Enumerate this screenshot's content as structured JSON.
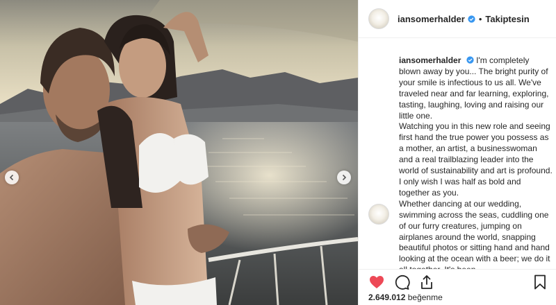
{
  "post": {
    "photo_alt": "Couple embracing on a boat at sunset",
    "carousel": {
      "prev_icon": "chevron-left-icon",
      "next_icon": "chevron-right-icon"
    }
  },
  "header": {
    "username": "iansomerhalder",
    "verified_icon": "verified-badge-icon",
    "separator": "•",
    "follow_label": "Takiptesin"
  },
  "caption": {
    "username": "iansomerhalder",
    "paragraphs": [
      "I'm completely blown away by you... The bright purity of your smile is infectious to us all. We've traveled near and far learning, exploring, tasting, laughing, loving and raising our little one.",
      "Watching you in this new role and seeing first hand the true power you possess as a mother, an artist, a businesswoman and a real trailblazing leader into the world of sustainability and art is profound. I only wish I was half as bold and together as you.",
      "Whether dancing at our wedding, swimming across the seas, cuddling one of our furry creatures, jumping on airplanes around the world, snapping beautiful photos or sitting hand and hand looking at the ocean with a beer; we do it all together. It's been"
    ]
  },
  "actions": {
    "like_icon": "heart-filled-icon",
    "comment_icon": "comment-icon",
    "share_icon": "share-icon",
    "save_icon": "bookmark-icon",
    "like_color": "#ed4956"
  },
  "likes": {
    "count": "2.649.012",
    "label": "beğenme"
  }
}
